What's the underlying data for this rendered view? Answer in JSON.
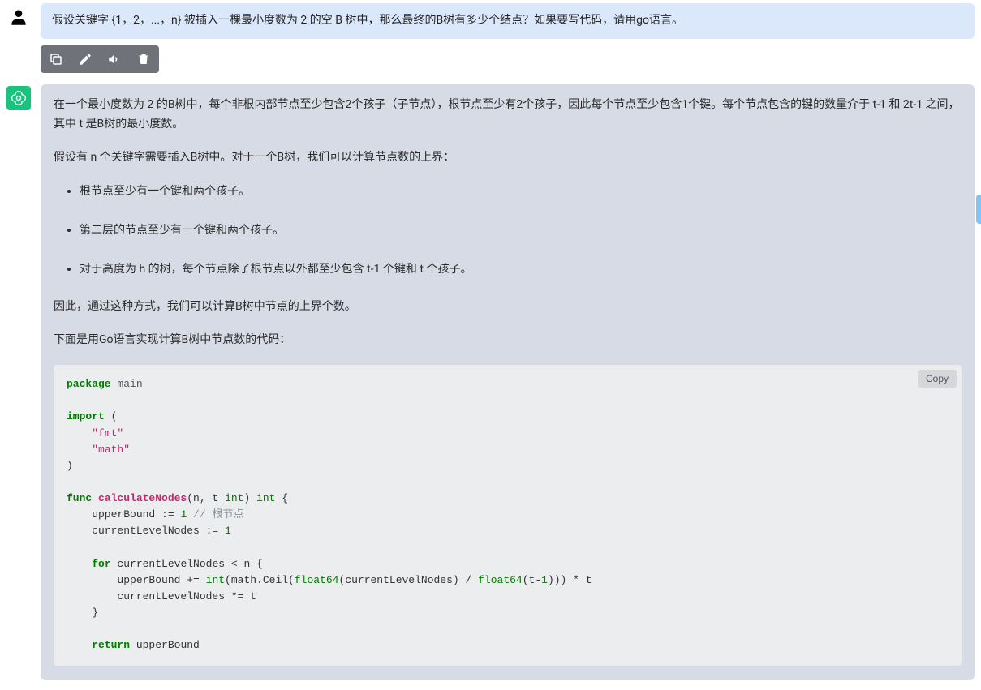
{
  "user_message": "假设关键字 {1，2，...，n} 被插入一棵最小度数为 2 的空 B 树中，那么最终的B树有多少个结点？如果要写代码，请用go语言。",
  "toolbar": {
    "copy": "copy-icon",
    "edit": "edit-icon",
    "audio": "audio-icon",
    "delete": "delete-icon"
  },
  "assistant": {
    "p1": "在一个最小度数为 2 的B树中，每个非根内部节点至少包含2个孩子（子节点），根节点至少有2个孩子，因此每个节点至少包含1个键。每个节点包含的键的数量介于 t-1 和 2t-1 之间，其中 t 是B树的最小度数。",
    "p2": "假设有 n 个关键字需要插入B树中。对于一个B树，我们可以计算节点数的上界：",
    "li1": "根节点至少有一个键和两个孩子。",
    "li2": "第二层的节点至少有一个键和两个孩子。",
    "li3": "对于高度为 h 的树，每个节点除了根节点以外都至少包含 t-1 个键和 t 个孩子。",
    "p3": "因此，通过这种方式，我们可以计算B树中节点的上界个数。",
    "p4": "下面是用Go语言实现计算B树中节点数的代码：",
    "copy_label": "Copy"
  },
  "code": {
    "kw_package": "package",
    "pkg_main": " main",
    "kw_import": "import",
    "paren_open": " (",
    "str_fmt": "\"fmt\"",
    "str_math": "\"math\"",
    "paren_close": ")",
    "kw_func": "func",
    "fn_name": " calculateNodes",
    "sig_open": "(n, t ",
    "typ_int1": "int",
    "sig_mid": ") ",
    "typ_int2": "int",
    "brace_open": " {",
    "line_ub1": "    upperBound := ",
    "num_1a": "1",
    "cmt_root": " // 根节点",
    "line_cl1": "    currentLevelNodes := ",
    "num_1b": "1",
    "kw_for": "for",
    "for_cond": " currentLevelNodes < n {",
    "line_ub2a": "        upperBound += ",
    "typ_int3": "int",
    "line_ub2b": "(math.Ceil(",
    "typ_f64a": "float64",
    "line_ub2c": "(currentLevelNodes) / ",
    "typ_f64b": "float64",
    "line_ub2d": "(t-",
    "num_1c": "1",
    "line_ub2e": "))) * t",
    "line_cl2": "        currentLevelNodes *= t",
    "brace_close_for": "    }",
    "kw_return": "return",
    "ret_val": " upperBound"
  }
}
